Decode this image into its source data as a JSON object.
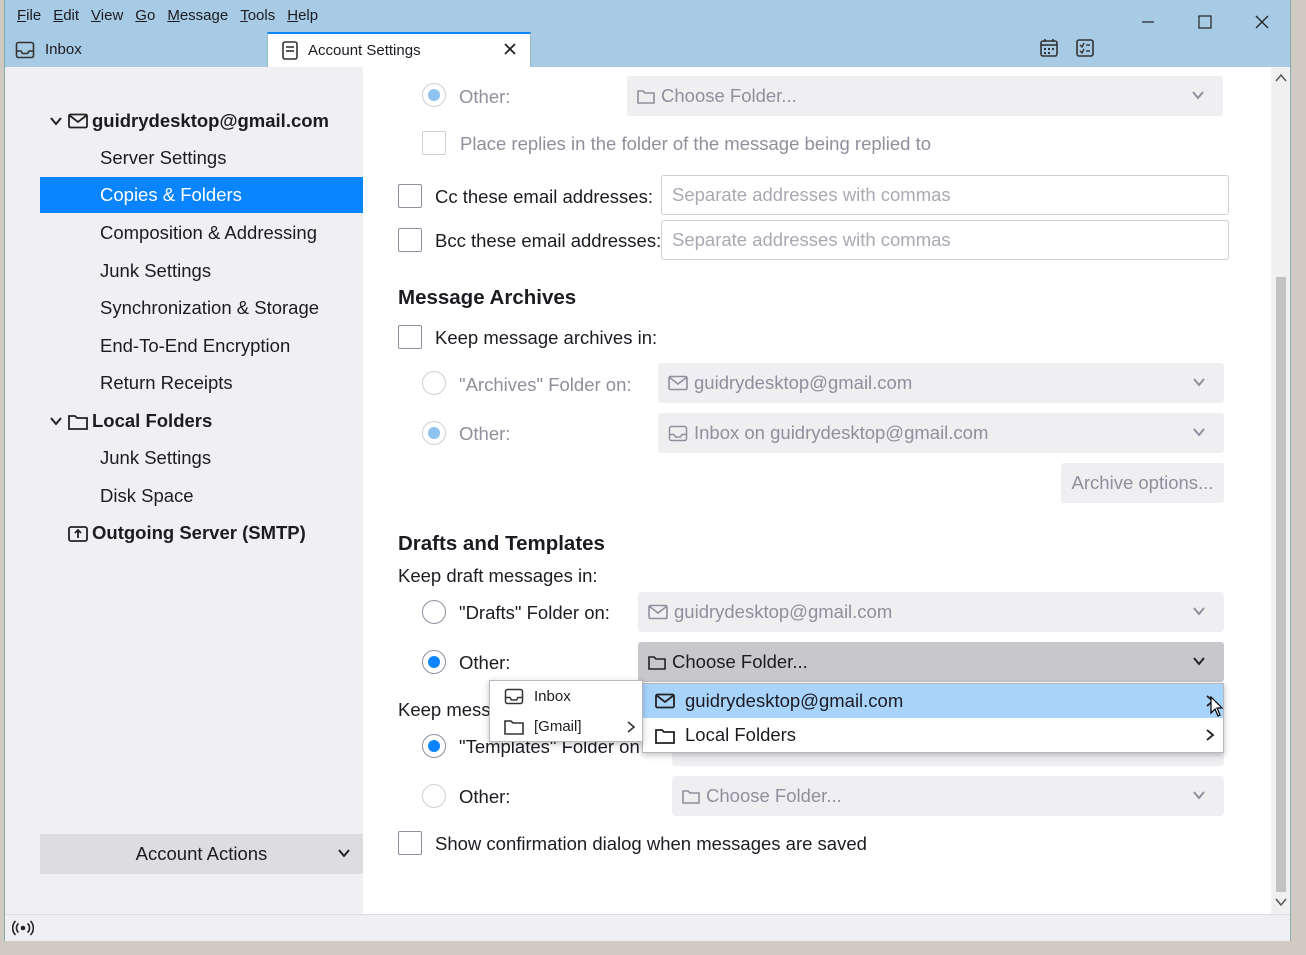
{
  "menubar": [
    "File",
    "Edit",
    "View",
    "Go",
    "Message",
    "Tools",
    "Help"
  ],
  "tabs": {
    "inbox": "Inbox",
    "settings": "Account Settings"
  },
  "sidebar": {
    "account": "guidrydesktop@gmail.com",
    "account_items": [
      "Server Settings",
      "Copies & Folders",
      "Composition & Addressing",
      "Junk Settings",
      "Synchronization & Storage",
      "End-To-End Encryption",
      "Return Receipts"
    ],
    "local_folders": "Local Folders",
    "local_items": [
      "Junk Settings",
      "Disk Space"
    ],
    "outgoing": "Outgoing Server (SMTP)",
    "account_actions": "Account Actions"
  },
  "sent": {
    "other_label": "Other:",
    "other_folder": "Choose Folder...",
    "place_replies": "Place replies in the folder of the message being replied to",
    "cc_label": "Cc these email addresses:",
    "cc_placeholder": "Separate addresses with commas",
    "bcc_label": "Bcc these email addresses:",
    "bcc_placeholder": "Separate addresses with commas"
  },
  "archives": {
    "heading": "Message Archives",
    "keep_label": "Keep message archives in:",
    "folder_on_label": "\"Archives\" Folder on:",
    "folder_on_value": "guidrydesktop@gmail.com",
    "other_label": "Other:",
    "other_value": "Inbox on guidrydesktop@gmail.com",
    "options_button": "Archive options..."
  },
  "drafts": {
    "heading": "Drafts and Templates",
    "keep_drafts": "Keep draft messages in:",
    "drafts_folder_label": "\"Drafts\" Folder on:",
    "drafts_folder_value": "guidrydesktop@gmail.com",
    "other_label": "Other:",
    "other_value": "Choose Folder...",
    "keep_templates": "Keep messa",
    "templates_folder_label": "\"Templates\" Folder on",
    "templates_other_label": "Other:",
    "templates_other_value": "Choose Folder...",
    "confirm_dialog": "Show confirmation dialog when messages are saved"
  },
  "popup": {
    "items": [
      "guidrydesktop@gmail.com",
      "Local Folders"
    ],
    "submenu": [
      "Inbox",
      "[Gmail]"
    ]
  },
  "colors": {
    "accent": "#0a84ff",
    "titlebar": "#a7cbe4",
    "highlight": "#a8d4fc"
  }
}
